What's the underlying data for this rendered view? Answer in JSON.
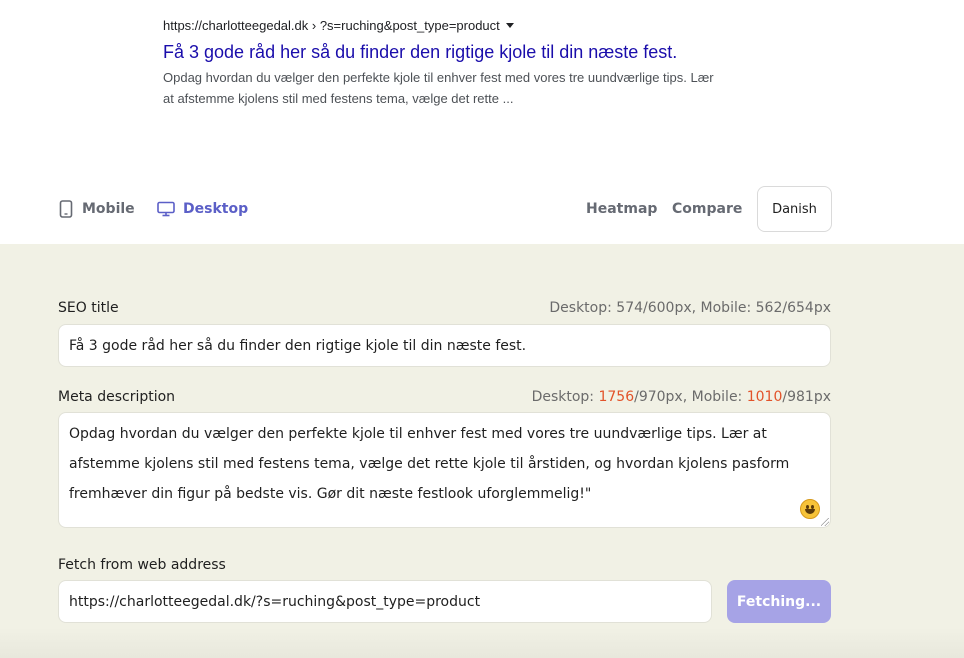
{
  "preview": {
    "url": "https://charlotteegedal.dk › ?s=ruching&post_type=product",
    "title": "Få 3 gode råd her så du finder den rigtige kjole til din næste fest.",
    "description_line1": "Opdag hvordan du vælger den perfekte kjole til enhver fest med vores tre uundværlige tips. Lær",
    "description_line2": "at afstemme kjolens stil med festens tema, vælge det rette ..."
  },
  "toolbar": {
    "mobile_label": "Mobile",
    "desktop_label": "Desktop",
    "heatmap_label": "Heatmap",
    "compare_label": "Compare",
    "language_label": "Danish"
  },
  "seo_title": {
    "label": "SEO title",
    "counter_desktop_prefix": "Desktop: ",
    "counter_desktop_value": "574",
    "counter_desktop_limit": "/600px",
    "counter_mobile_prefix": ", Mobile: ",
    "counter_mobile_value": "562",
    "counter_mobile_limit": "/654px",
    "value": "Få 3 gode råd her så du finder den rigtige kjole til din næste fest."
  },
  "meta_description": {
    "label": "Meta description",
    "counter_desktop_prefix": "Desktop: ",
    "counter_desktop_value": "1756",
    "counter_desktop_limit": "/970px",
    "counter_mobile_prefix": ", Mobile: ",
    "counter_mobile_value": "1010",
    "counter_mobile_limit": "/981px",
    "line1": "Opdag hvordan du vælger den perfekte kjole til enhver fest med vores tre uundværlige tips. Lær at",
    "line2": "afstemme kjolens stil med festens tema, vælge det rette kjole til årstiden, og hvordan kjolens pasform",
    "line3": "fremhæver din figur på bedste vis. Gør dit næste festlook uforglemmelig!\""
  },
  "fetch": {
    "label": "Fetch from web address",
    "value": "https://charlotteegedal.dk/?s=ruching&post_type=product",
    "button_label": "Fetching..."
  },
  "colors": {
    "accent": "#5b5fc7",
    "link": "#1a0dab",
    "over_limit": "#e2532a",
    "panel_bg": "#f1f1e5",
    "button_disabled": "#a6a3e6"
  }
}
